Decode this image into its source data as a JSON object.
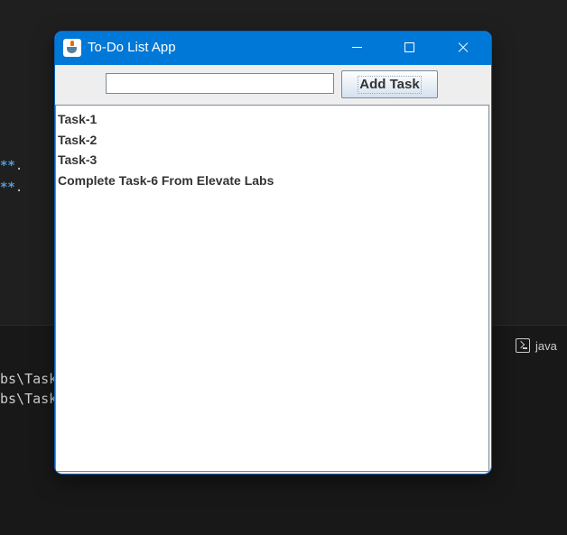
{
  "background": {
    "editor_fragments": [
      "**",
      "**"
    ],
    "terminal_lines": [
      "bs\\Task",
      "bs\\Task"
    ],
    "terminal_tab_label": "java",
    "terminal_tab_icon": "terminal-icon"
  },
  "window": {
    "title": "To-Do List App",
    "icon": "java-icon",
    "titlebar_color": "#0078d7",
    "controls": [
      "minimize-icon",
      "maximize-icon",
      "close-icon"
    ]
  },
  "toolbar": {
    "input_value": "",
    "input_placeholder": "",
    "add_button_label": "Add Task"
  },
  "tasks": [
    "Task-1",
    "Task-2",
    "Task-3",
    "Complete Task-6 From Elevate Labs"
  ]
}
